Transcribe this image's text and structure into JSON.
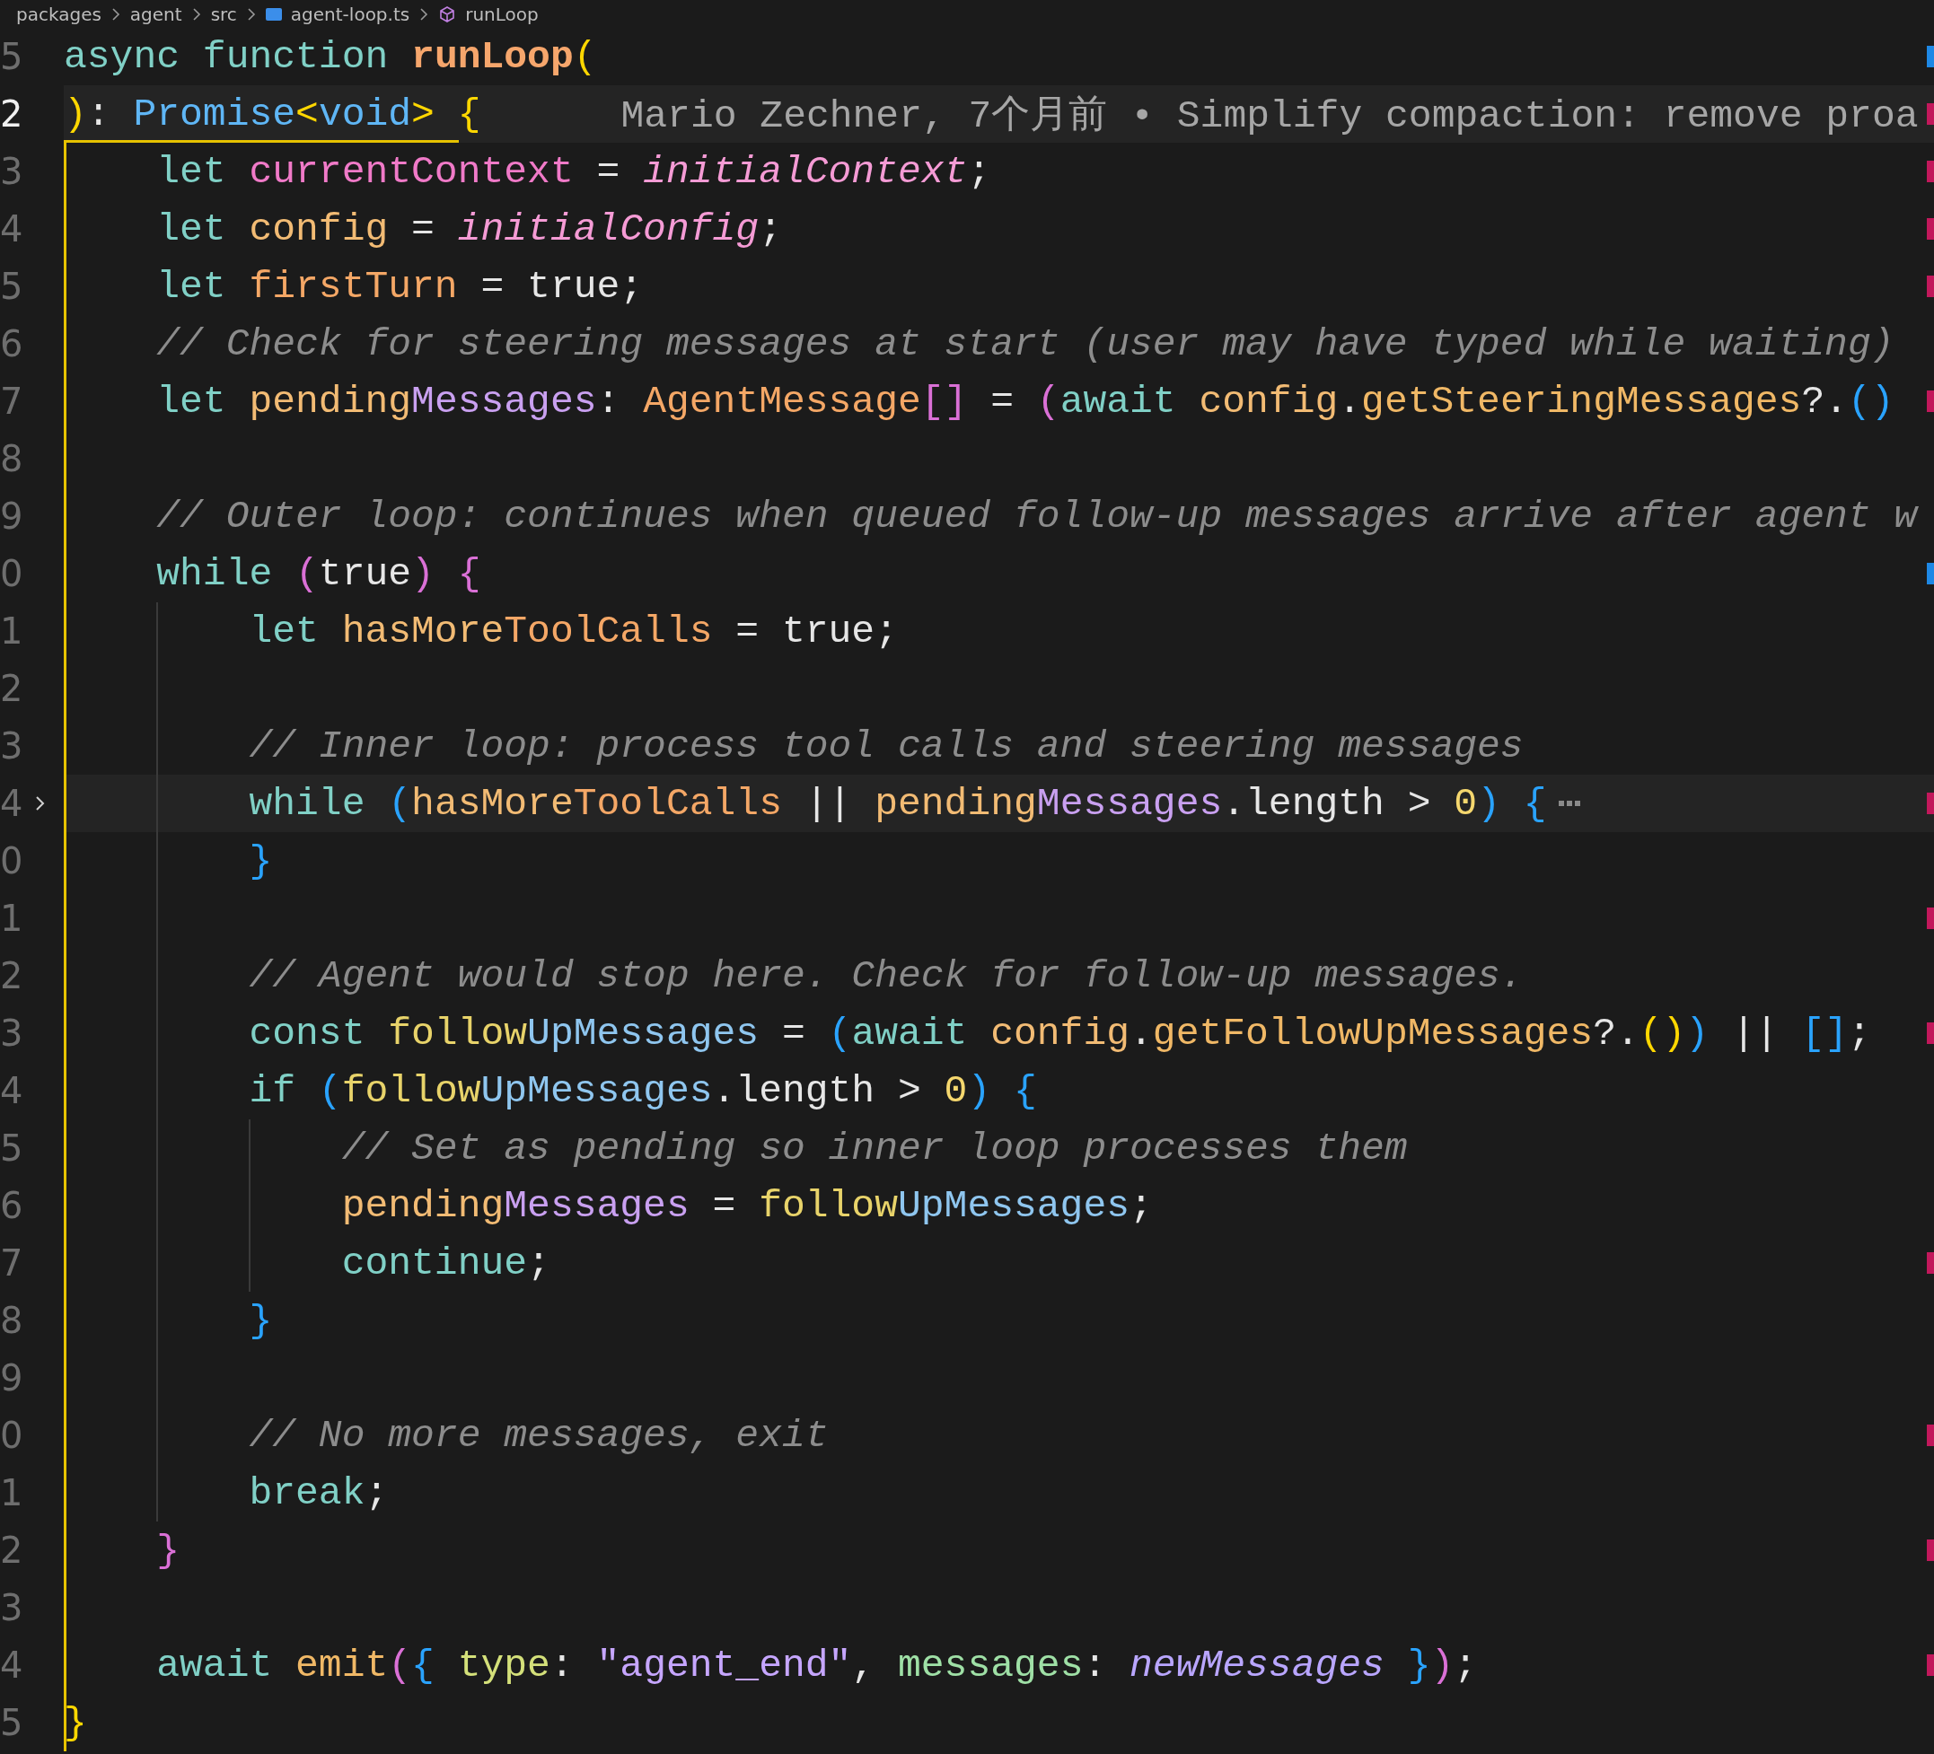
{
  "breadcrumb": [
    {
      "kind": "folder",
      "label": "packages"
    },
    {
      "kind": "folder",
      "label": "agent"
    },
    {
      "kind": "folder",
      "label": "src"
    },
    {
      "kind": "file",
      "label": "agent-loop.ts"
    },
    {
      "kind": "symbol",
      "label": "runLoop"
    }
  ],
  "lines": [
    {
      "number": "5",
      "current": false,
      "folded": false,
      "modified": false,
      "added": true,
      "tokens": [
        {
          "kind": "kw",
          "text": "async function "
        },
        {
          "kind": "fn",
          "text": "runLoop"
        },
        {
          "kind": "by",
          "text": "("
        }
      ]
    },
    {
      "number": "2",
      "current": true,
      "folded": false,
      "modified": true,
      "added": false,
      "blame": "Mario Zechner, 7个月前 • Simplify compaction: remove proa",
      "tokens": [
        {
          "kind": "by",
          "text": ")"
        },
        {
          "kind": "p",
          "text": ": "
        },
        {
          "kind": "type",
          "text": "Promise"
        },
        {
          "kind": "by",
          "text": "<"
        },
        {
          "kind": "type",
          "text": "void"
        },
        {
          "kind": "by",
          "text": ">"
        },
        {
          "kind": "by",
          "text": " {"
        }
      ]
    },
    {
      "number": "3",
      "current": false,
      "folded": false,
      "modified": true,
      "added": false,
      "tokens": [
        {
          "kind": "kw",
          "text": "    let "
        },
        {
          "kind": "pink",
          "text": "currentContext"
        },
        {
          "kind": "p",
          "text": " = "
        },
        {
          "kind": "param",
          "text": "initialContext"
        },
        {
          "kind": "p",
          "text": ";"
        }
      ]
    },
    {
      "number": "4",
      "current": false,
      "folded": false,
      "modified": true,
      "added": false,
      "tokens": [
        {
          "kind": "kw",
          "text": "    let "
        },
        {
          "kind": "var",
          "text": "config"
        },
        {
          "kind": "p",
          "text": " = "
        },
        {
          "kind": "param",
          "text": "initialConfig"
        },
        {
          "kind": "p",
          "text": ";"
        }
      ]
    },
    {
      "number": "5",
      "current": false,
      "folded": false,
      "modified": true,
      "added": false,
      "tokens": [
        {
          "kind": "kw",
          "text": "    let "
        },
        {
          "kind": "orange",
          "text": "firstTurn"
        },
        {
          "kind": "p",
          "text": " = true;"
        }
      ]
    },
    {
      "number": "6",
      "current": false,
      "folded": false,
      "modified": false,
      "added": false,
      "tokens": [
        {
          "kind": "comment",
          "text": "    // Check for steering messages at start (user may have typed while waiting)"
        }
      ]
    },
    {
      "number": "7",
      "current": false,
      "folded": false,
      "modified": true,
      "added": false,
      "tokens": [
        {
          "kind": "kw",
          "text": "    let "
        },
        {
          "kind": "var",
          "text": "pending"
        },
        {
          "kind": "purple",
          "text": "Messages"
        },
        {
          "kind": "p",
          "text": ": "
        },
        {
          "kind": "orange",
          "text": "AgentMessage"
        },
        {
          "kind": "bp",
          "text": "[]"
        },
        {
          "kind": "p",
          "text": " = "
        },
        {
          "kind": "bp",
          "text": "("
        },
        {
          "kind": "kw",
          "text": "await "
        },
        {
          "kind": "var",
          "text": "config"
        },
        {
          "kind": "p",
          "text": "."
        },
        {
          "kind": "fn2",
          "text": "getSteeringMessages"
        },
        {
          "kind": "p",
          "text": "?."
        },
        {
          "kind": "bb",
          "text": "()"
        }
      ]
    },
    {
      "number": "8",
      "current": false,
      "folded": false,
      "modified": false,
      "added": false
    },
    {
      "number": "9",
      "current": false,
      "folded": false,
      "modified": false,
      "added": false,
      "tokens": [
        {
          "kind": "comment",
          "text": "    // Outer loop: continues when queued follow-up messages arrive after agent w"
        }
      ]
    },
    {
      "number": "0",
      "current": false,
      "folded": false,
      "modified": false,
      "added": true,
      "tokens": [
        {
          "kind": "kw",
          "text": "    while "
        },
        {
          "kind": "bp",
          "text": "("
        },
        {
          "kind": "p",
          "text": "true"
        },
        {
          "kind": "bp",
          "text": ") {"
        }
      ]
    },
    {
      "number": "1",
      "current": false,
      "folded": false,
      "modified": false,
      "added": false,
      "tokens": [
        {
          "kind": "kw",
          "text": "        let "
        },
        {
          "kind": "var",
          "text": "hasMore"
        },
        {
          "kind": "orange",
          "text": "ToolCalls"
        },
        {
          "kind": "p",
          "text": " = true;"
        }
      ]
    },
    {
      "number": "2",
      "current": false,
      "folded": false,
      "modified": false,
      "added": false
    },
    {
      "number": "3",
      "current": false,
      "folded": false,
      "modified": false,
      "added": false,
      "tokens": [
        {
          "kind": "comment",
          "text": "        // Inner loop: process tool calls and steering messages"
        }
      ]
    },
    {
      "number": "4",
      "current": false,
      "folded": true,
      "modified": true,
      "added": false,
      "tokens": [
        {
          "kind": "kw",
          "text": "        while "
        },
        {
          "kind": "bb",
          "text": "("
        },
        {
          "kind": "var",
          "text": "hasMore"
        },
        {
          "kind": "orange",
          "text": "ToolCalls"
        },
        {
          "kind": "p",
          "text": " || "
        },
        {
          "kind": "var",
          "text": "pending"
        },
        {
          "kind": "purple",
          "text": "Messages"
        },
        {
          "kind": "p",
          "text": ".length > "
        },
        {
          "kind": "num",
          "text": "0"
        },
        {
          "kind": "bb",
          "text": ") {"
        }
      ]
    },
    {
      "number": "0",
      "current": false,
      "folded": false,
      "modified": false,
      "added": false,
      "tokens": [
        {
          "kind": "bb",
          "text": "        }"
        }
      ]
    },
    {
      "number": "1",
      "current": false,
      "folded": false,
      "modified": true,
      "added": false
    },
    {
      "number": "2",
      "current": false,
      "folded": false,
      "modified": false,
      "added": false,
      "tokens": [
        {
          "kind": "comment",
          "text": "        // Agent would stop here. Check for follow-up messages."
        }
      ]
    },
    {
      "number": "3",
      "current": false,
      "folded": false,
      "modified": true,
      "added": false,
      "tokens": [
        {
          "kind": "kw",
          "text": "        const "
        },
        {
          "kind": "yellow",
          "text": "follow"
        },
        {
          "kind": "blue",
          "text": "UpMessages"
        },
        {
          "kind": "p",
          "text": " = "
        },
        {
          "kind": "bb",
          "text": "("
        },
        {
          "kind": "kw",
          "text": "await "
        },
        {
          "kind": "var",
          "text": "config"
        },
        {
          "kind": "p",
          "text": "."
        },
        {
          "kind": "fn2",
          "text": "getFollowUpMessages"
        },
        {
          "kind": "p",
          "text": "?."
        },
        {
          "kind": "by",
          "text": "()"
        },
        {
          "kind": "bb",
          "text": ")"
        },
        {
          "kind": "p",
          "text": " || "
        },
        {
          "kind": "bb",
          "text": "[]"
        },
        {
          "kind": "p",
          "text": ";"
        }
      ]
    },
    {
      "number": "4",
      "current": false,
      "folded": false,
      "modified": false,
      "added": false,
      "tokens": [
        {
          "kind": "kw",
          "text": "        if "
        },
        {
          "kind": "bb",
          "text": "("
        },
        {
          "kind": "yellow",
          "text": "follow"
        },
        {
          "kind": "blue",
          "text": "UpMessages"
        },
        {
          "kind": "p",
          "text": ".length > "
        },
        {
          "kind": "num",
          "text": "0"
        },
        {
          "kind": "bb",
          "text": ") {"
        }
      ]
    },
    {
      "number": "5",
      "current": false,
      "folded": false,
      "modified": false,
      "added": false,
      "tokens": [
        {
          "kind": "comment",
          "text": "            // Set as pending so inner loop processes them"
        }
      ]
    },
    {
      "number": "6",
      "current": false,
      "folded": false,
      "modified": false,
      "added": false,
      "tokens": [
        {
          "kind": "var",
          "text": "            pending"
        },
        {
          "kind": "purple",
          "text": "Messages"
        },
        {
          "kind": "p",
          "text": " = "
        },
        {
          "kind": "yellow",
          "text": "follow"
        },
        {
          "kind": "blue",
          "text": "UpMessages"
        },
        {
          "kind": "p",
          "text": ";"
        }
      ]
    },
    {
      "number": "7",
      "current": false,
      "folded": false,
      "modified": true,
      "added": false,
      "tokens": [
        {
          "kind": "kw",
          "text": "            continue"
        },
        {
          "kind": "p",
          "text": ";"
        }
      ]
    },
    {
      "number": "8",
      "current": false,
      "folded": false,
      "modified": false,
      "added": false,
      "tokens": [
        {
          "kind": "bb",
          "text": "        }"
        }
      ]
    },
    {
      "number": "9",
      "current": false,
      "folded": false,
      "modified": false,
      "added": false
    },
    {
      "number": "0",
      "current": false,
      "folded": false,
      "modified": true,
      "added": false,
      "tokens": [
        {
          "kind": "comment",
          "text": "        // No more messages, exit"
        }
      ]
    },
    {
      "number": "1",
      "current": false,
      "folded": false,
      "modified": false,
      "added": false,
      "tokens": [
        {
          "kind": "kw",
          "text": "        break"
        },
        {
          "kind": "p",
          "text": ";"
        }
      ]
    },
    {
      "number": "2",
      "current": false,
      "folded": false,
      "modified": true,
      "added": false,
      "tokens": [
        {
          "kind": "bp",
          "text": "    }"
        }
      ]
    },
    {
      "number": "3",
      "current": false,
      "folded": false,
      "modified": false,
      "added": false
    },
    {
      "number": "4",
      "current": false,
      "folded": false,
      "modified": true,
      "added": false,
      "tokens": [
        {
          "kind": "kw",
          "text": "    await "
        },
        {
          "kind": "fn2",
          "text": "emit"
        },
        {
          "kind": "bp",
          "text": "("
        },
        {
          "kind": "bb",
          "text": "{"
        },
        {
          "kind": "prop",
          "text": " type"
        },
        {
          "kind": "p",
          "text": ": "
        },
        {
          "kind": "str",
          "text": "\"agent_end\""
        },
        {
          "kind": "p",
          "text": ", "
        },
        {
          "kind": "prop2",
          "text": "messages"
        },
        {
          "kind": "p",
          "text": ": "
        },
        {
          "kind": "param2",
          "text": "newMessages"
        },
        {
          "kind": "bb",
          "text": " }"
        },
        {
          "kind": "bp",
          "text": ")"
        },
        {
          "kind": "p",
          "text": ";"
        }
      ]
    },
    {
      "number": "5",
      "current": false,
      "folded": false,
      "modified": false,
      "added": false,
      "tokens": [
        {
          "kind": "by",
          "text": "}"
        }
      ]
    }
  ]
}
